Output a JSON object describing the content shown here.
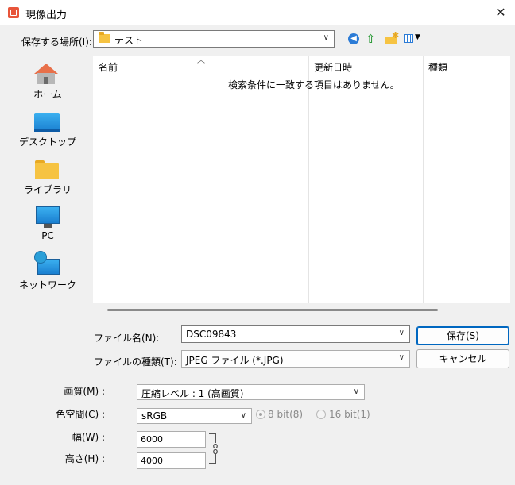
{
  "window": {
    "title": "現像出力",
    "close_glyph": "✕"
  },
  "location": {
    "label": "保存する場所(I):",
    "value": "テスト"
  },
  "places": [
    {
      "label": "ホーム",
      "icon": "home-icon"
    },
    {
      "label": "デスクトップ",
      "icon": "desktop-icon"
    },
    {
      "label": "ライブラリ",
      "icon": "library-icon"
    },
    {
      "label": "PC",
      "icon": "pc-icon"
    },
    {
      "label": "ネットワーク",
      "icon": "network-icon"
    }
  ],
  "list": {
    "columns": [
      "名前",
      "更新日時",
      "種類"
    ],
    "empty_message": "検索条件に一致する項目はありません。"
  },
  "file": {
    "name_label": "ファイル名(N):",
    "name_value": "DSC09843",
    "type_label": "ファイルの種類(T):",
    "type_value": "JPEG ファイル (*.JPG)"
  },
  "buttons": {
    "save": "保存(S)",
    "cancel": "キャンセル"
  },
  "options": {
    "quality_label": "画質(M) :",
    "quality_value": "圧縮レベル : 1 (高画質)",
    "colorspace_label": "色空間(C) :",
    "colorspace_value": "sRGB",
    "bit8_label": "8 bit(8)",
    "bit16_label": "16 bit(1)",
    "width_label": "幅(W) :",
    "width_value": "6000",
    "height_label": "高さ(H) :",
    "height_value": "4000"
  },
  "colors": {
    "accent": "#0067c0",
    "folder": "#f6c342",
    "app_icon": "#e8553a"
  }
}
